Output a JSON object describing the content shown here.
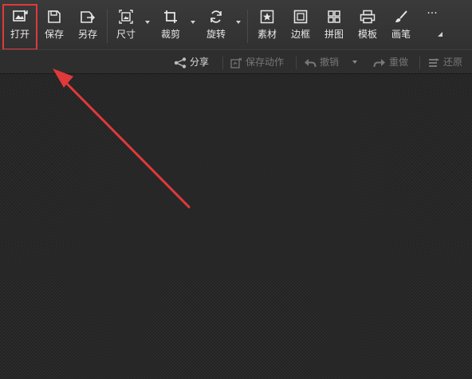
{
  "toolbar": {
    "open": "打开",
    "save": "保存",
    "save_as": "另存",
    "size": "尺寸",
    "crop": "裁剪",
    "rotate": "旋转",
    "material": "素材",
    "border": "边框",
    "collage": "拼图",
    "template": "模板",
    "brush": "画笔",
    "more": "···"
  },
  "subbar": {
    "share": "分享",
    "save_action": "保存动作",
    "undo": "撤销",
    "redo": "重做",
    "restore": "还原"
  },
  "colors": {
    "highlight": "#e0393b",
    "arrow": "#e0393b"
  }
}
